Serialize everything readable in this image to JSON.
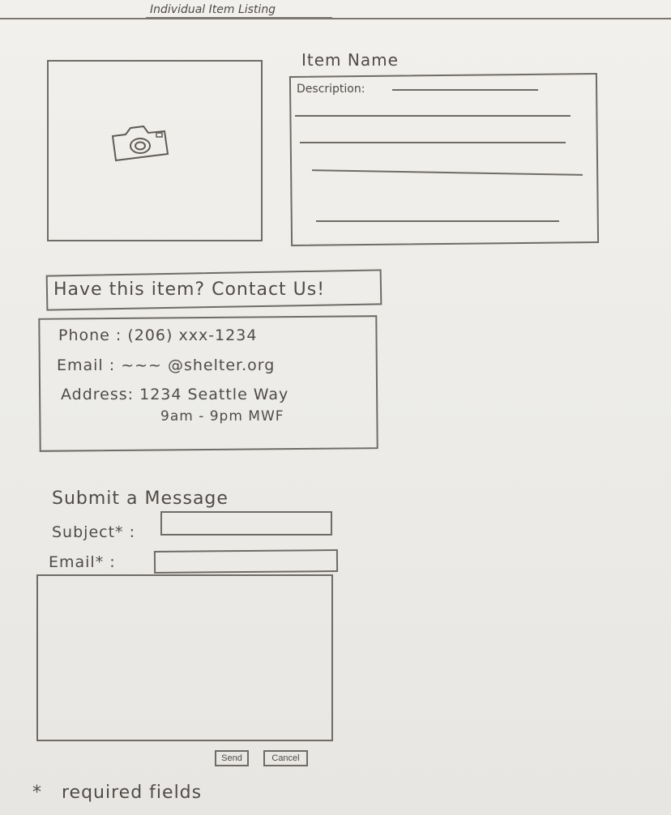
{
  "page": {
    "title": "Individual Item Listing"
  },
  "item": {
    "name": "Item Name",
    "photo_icon": "camera-icon",
    "description_label": "Description:"
  },
  "contact": {
    "heading": "Have this item? Contact Us!",
    "phone": "Phone : (206) xxx-1234",
    "email": "Email : ~~~ @shelter.org",
    "address": "Address: 1234 Seattle Way",
    "hours": "9am - 9pm MWF"
  },
  "message_form": {
    "title": "Submit a Message",
    "subject_label": "Subject* :",
    "email_label": "Email* :",
    "send_label": "Send",
    "cancel_label": "Cancel",
    "required_marker": "*",
    "required_note": "required fields"
  }
}
